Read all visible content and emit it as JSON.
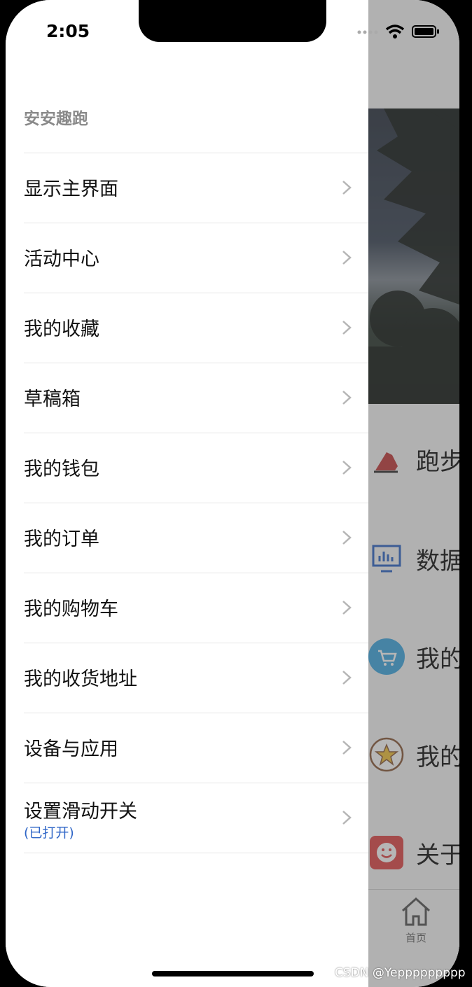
{
  "status_bar": {
    "time": "2:05"
  },
  "drawer": {
    "title": "安安趣跑",
    "items": [
      {
        "label": "显示主界面"
      },
      {
        "label": "活动中心"
      },
      {
        "label": "我的收藏"
      },
      {
        "label": "草稿箱"
      },
      {
        "label": "我的钱包"
      },
      {
        "label": "我的订单"
      },
      {
        "label": "我的购物车"
      },
      {
        "label": "我的收货地址"
      },
      {
        "label": "设备与应用"
      },
      {
        "label": "设置滑动开关",
        "sublabel": "(已打开)"
      }
    ]
  },
  "background": {
    "rows": [
      {
        "label": "跑步",
        "icon": "running-shoe-icon"
      },
      {
        "label": "数据",
        "icon": "data-chart-icon"
      },
      {
        "label": "我的",
        "icon": "shopping-cart-icon"
      },
      {
        "label": "我的",
        "icon": "star-icon"
      },
      {
        "label": "关于",
        "icon": "smiley-icon"
      }
    ],
    "tabbar": {
      "home_label": "首页",
      "icon": "home-icon"
    }
  },
  "watermark": "CSDN @Yeppppppppp",
  "colors": {
    "accent_blue": "#2f66c7",
    "title_gray": "#8a8a8a",
    "divider": "#e6e6e6"
  }
}
